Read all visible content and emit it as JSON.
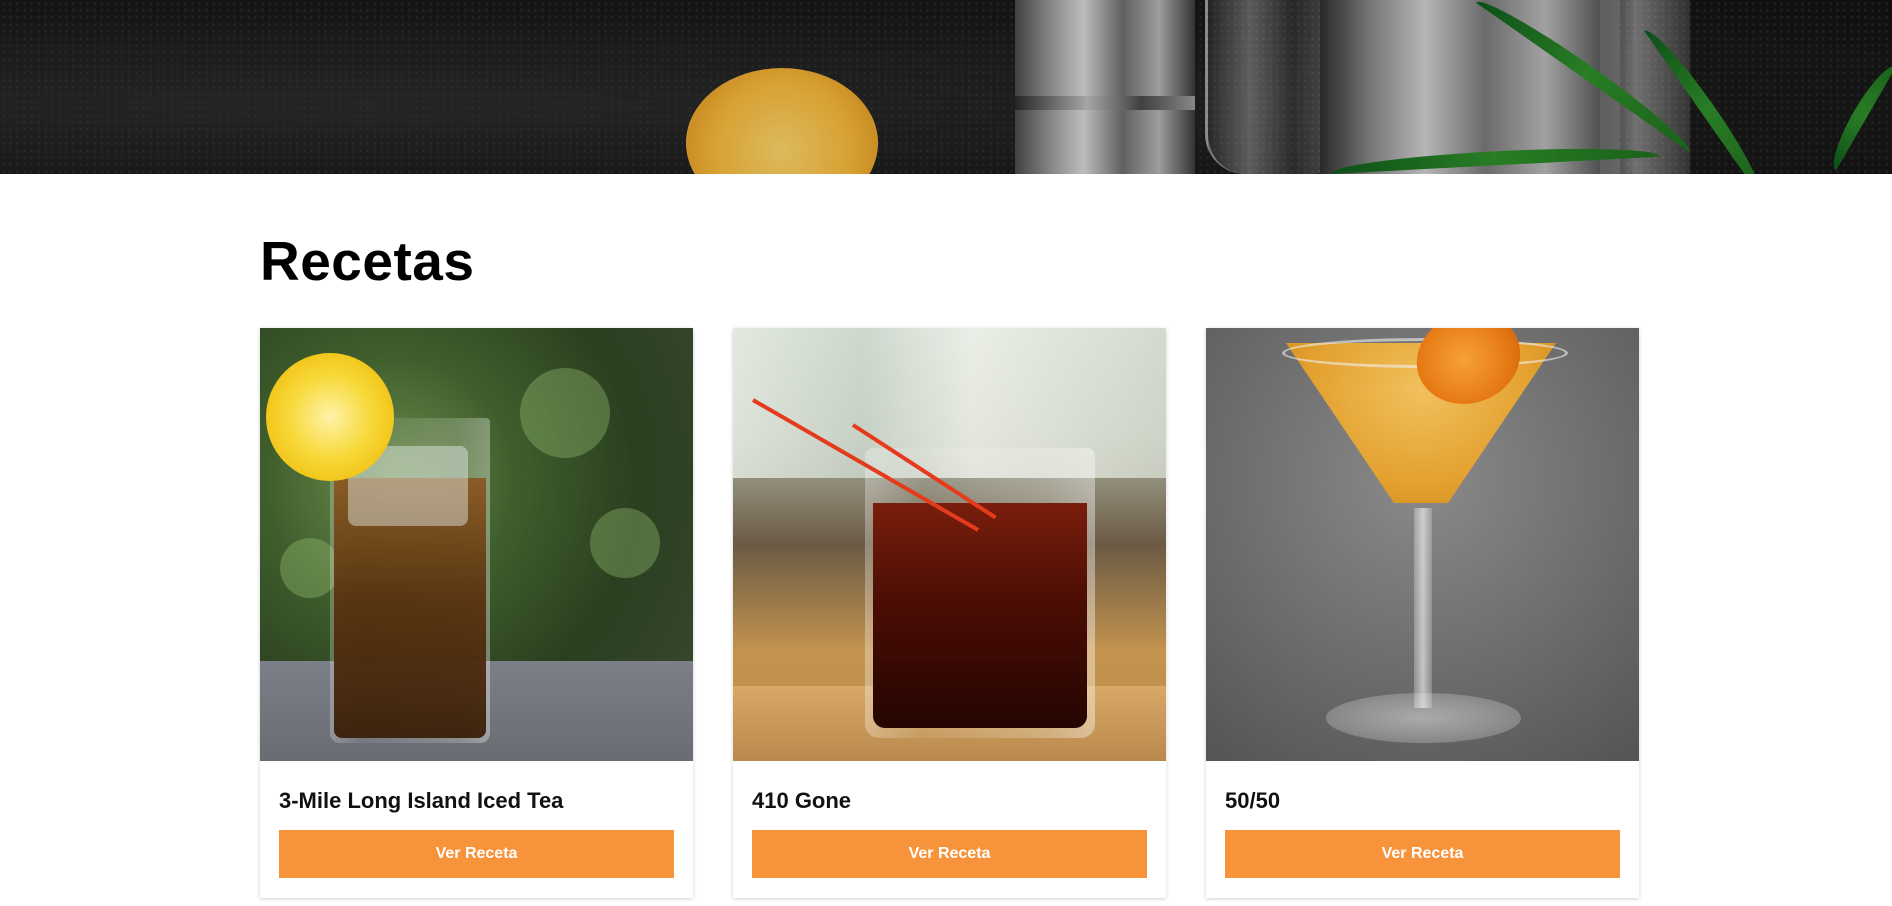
{
  "section": {
    "heading": "Recetas"
  },
  "recipes": [
    {
      "title": "3-Mile Long Island Iced Tea",
      "button_label": "Ver Receta",
      "photo": "iced-tea-photo"
    },
    {
      "title": "410 Gone",
      "button_label": "Ver Receta",
      "photo": "cocktail-glass-photo"
    },
    {
      "title": "50/50",
      "button_label": "Ver Receta",
      "photo": "martini-photo"
    }
  ],
  "colors": {
    "accent": "#f7933b",
    "hero_background": "#1a1a1a"
  }
}
